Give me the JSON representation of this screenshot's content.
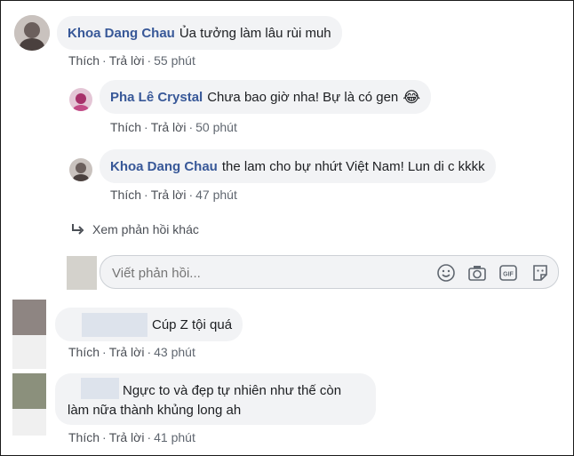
{
  "comments": [
    {
      "author": "Khoa Dang Chau",
      "text": "Ủa tưởng làm lâu rùi muh",
      "like": "Thích",
      "reply": "Trả lời",
      "time": "55 phút"
    },
    {
      "author": "Pha Lê Crystal",
      "text": "Chưa bao giờ nha! Bự là có gen",
      "emoji": "😂",
      "like": "Thích",
      "reply": "Trả lời",
      "time": "50 phút"
    },
    {
      "author": "Khoa Dang Chau",
      "text": "the lam cho bự nhứt Việt Nam! Lun di c kkkk",
      "like": "Thích",
      "reply": "Trả lời",
      "time": "47 phút"
    },
    {
      "author": "",
      "text": "Cúp Z tội quá",
      "like": "Thích",
      "reply": "Trả lời",
      "time": "43 phút"
    },
    {
      "author": "",
      "text_line1": "Ngực to và đẹp tự nhiên như thế còn",
      "text_line2": "làm nữa thành khủng long ah",
      "like": "Thích",
      "reply": "Trả lời",
      "time": "41 phút"
    }
  ],
  "more_replies": "Xem phản hồi khác",
  "reply_input": {
    "placeholder": "Viết phản hồi..."
  },
  "icons": [
    "emoji-icon",
    "camera-icon",
    "gif-icon",
    "sticker-icon",
    "reply-arrow-icon"
  ],
  "colors": {
    "author": "#385898",
    "bubble": "#f2f3f5",
    "meta": "#606770"
  }
}
